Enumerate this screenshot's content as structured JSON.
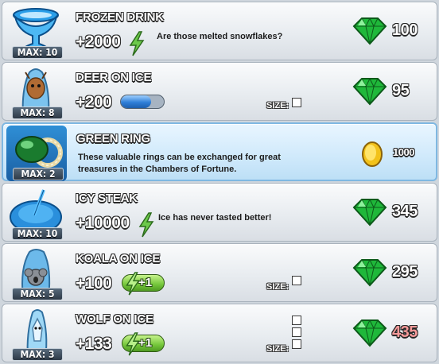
{
  "shop_items": [
    {
      "title": "FROZEN DRINK",
      "max": "MAX: 10",
      "bonus": "+2000",
      "description": "Are those melted snowflakes?",
      "price": "100",
      "currency": "gem-icon"
    },
    {
      "title": "DEER ON ICE",
      "max": "MAX: 8",
      "bonus": "+200",
      "energy_bar_fill": 0.7,
      "size_label": "SIZE:",
      "size_cells": 1,
      "price": "95",
      "currency": "gem-icon"
    },
    {
      "title": "GREEN RING",
      "max": "MAX: 2",
      "description_line1": "These valuable rings can be exchanged for great",
      "description_line2": "treasures in the Chambers of Fortune.",
      "price": "1000",
      "currency": "gold-coin-icon"
    },
    {
      "title": "ICY STEAK",
      "max": "MAX: 10",
      "bonus": "+10000",
      "description": "Ice has never tasted better!",
      "price": "345",
      "currency": "gem-icon"
    },
    {
      "title": "KOALA ON ICE",
      "max": "MAX: 5",
      "bonus": "+100",
      "plus_label": "+1",
      "size_label": "SIZE:",
      "size_cells": 1,
      "price": "295",
      "currency": "gem-icon"
    },
    {
      "title": "WOLF ON ICE",
      "max": "MAX: 3",
      "bonus": "+133",
      "plus_label": "+1",
      "size_label": "SIZE:",
      "size_cells": 3,
      "price": "435",
      "price_color": "#f59a9a",
      "currency": "gem-icon"
    }
  ],
  "colors": {
    "gem": "#1fb83a",
    "energy_bolt": "#56b93a",
    "coin": "#f2c21a",
    "highlight_row": "#cfe9fb"
  }
}
